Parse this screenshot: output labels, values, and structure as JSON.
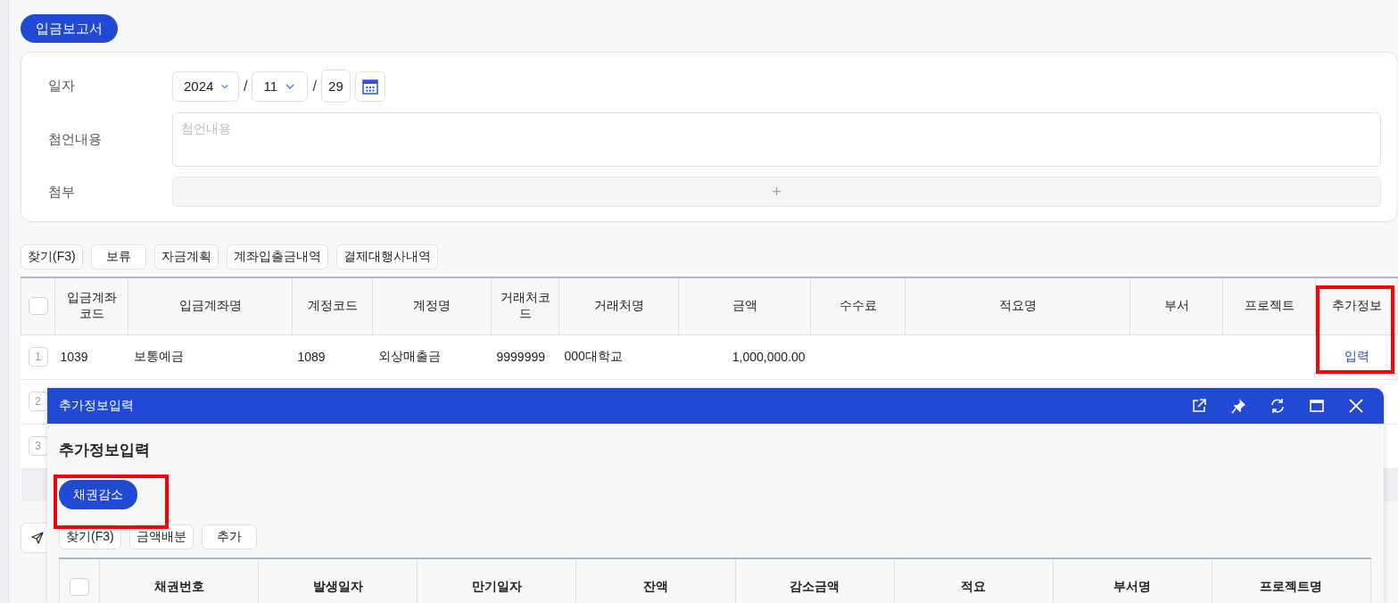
{
  "report_button": "입금보고서",
  "form": {
    "date": {
      "label": "일자",
      "year": "2024",
      "month": "11",
      "day": "29",
      "separator": "/"
    },
    "memo": {
      "label": "첨언내용",
      "placeholder": "첨언내용"
    },
    "attachment": {
      "label": "첨부",
      "add": "+"
    }
  },
  "toolbar": [
    "찾기(F3)",
    "보류",
    "자금계획",
    "계좌입출금내역",
    "결제대행사내역"
  ],
  "table": {
    "select_all_checked": false,
    "columns": [
      {
        "label": "입금계좌코드",
        "kind": "text",
        "highlighted": false
      },
      {
        "label": "입금계좌명",
        "kind": "text",
        "highlighted": false
      },
      {
        "label": "계정코드",
        "kind": "text",
        "highlighted": false
      },
      {
        "label": "계정명",
        "kind": "text",
        "highlighted": false
      },
      {
        "label": "거래처코드",
        "kind": "text",
        "highlighted": false
      },
      {
        "label": "거래처명",
        "kind": "text",
        "highlighted": false
      },
      {
        "label": "금액",
        "kind": "amount",
        "highlighted": false
      },
      {
        "label": "수수료",
        "kind": "amount",
        "highlighted": false
      },
      {
        "label": "적요명",
        "kind": "text",
        "highlighted": false
      },
      {
        "label": "부서",
        "kind": "text",
        "highlighted": false
      },
      {
        "label": "프로젝트",
        "kind": "text",
        "highlighted": false
      },
      {
        "label": "추가정보",
        "kind": "action",
        "highlighted": true
      }
    ],
    "rows": [
      {
        "number": "1",
        "cells": [
          "1039",
          "보통예금",
          "1089",
          "외상매출금",
          "9999999",
          "000대학교",
          "1,000,000.00",
          null,
          null,
          null,
          null,
          {
            "kind": "link",
            "text": "입력"
          }
        ]
      },
      {
        "number": "2",
        "cells": []
      },
      {
        "number": "3",
        "cells": []
      }
    ]
  },
  "modal": {
    "title": "추가정보입력",
    "heading": "추가정보입력",
    "tab_button": {
      "label": "채권감소",
      "highlighted": true
    },
    "toolbar": [
      "찾기(F3)",
      "금액배분",
      "추가"
    ],
    "select_all_checked": false,
    "columns": [
      "채권번호",
      "발생일자",
      "만기일자",
      "잔액",
      "감소금액",
      "적요",
      "부서명",
      "프로젝트명"
    ]
  }
}
